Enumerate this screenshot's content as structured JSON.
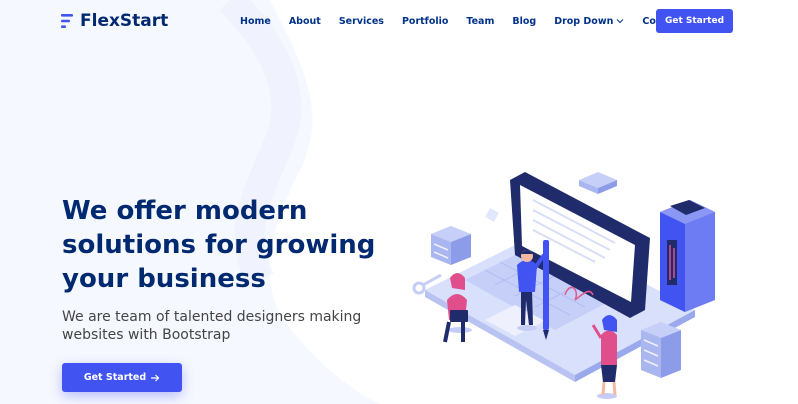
{
  "brand": {
    "name": "FlexStart",
    "primary_color": "#4154f1",
    "heading_color": "#012970",
    "logo_icon": "flexstart-logo-icon"
  },
  "nav": {
    "items": [
      {
        "label": "Home"
      },
      {
        "label": "About"
      },
      {
        "label": "Services"
      },
      {
        "label": "Portfolio"
      },
      {
        "label": "Team"
      },
      {
        "label": "Blog"
      },
      {
        "label": "Drop Down",
        "icon": "chevron-down-icon"
      },
      {
        "label": "Contact"
      }
    ],
    "cta_label": "Get Started"
  },
  "hero": {
    "title": "We offer modern solutions for growing your business",
    "subtitle": "We are team of talented designers making websites with Bootstrap",
    "button_label": "Get Started",
    "button_icon": "arrow-right-icon",
    "illustration": "hero-illustration"
  }
}
